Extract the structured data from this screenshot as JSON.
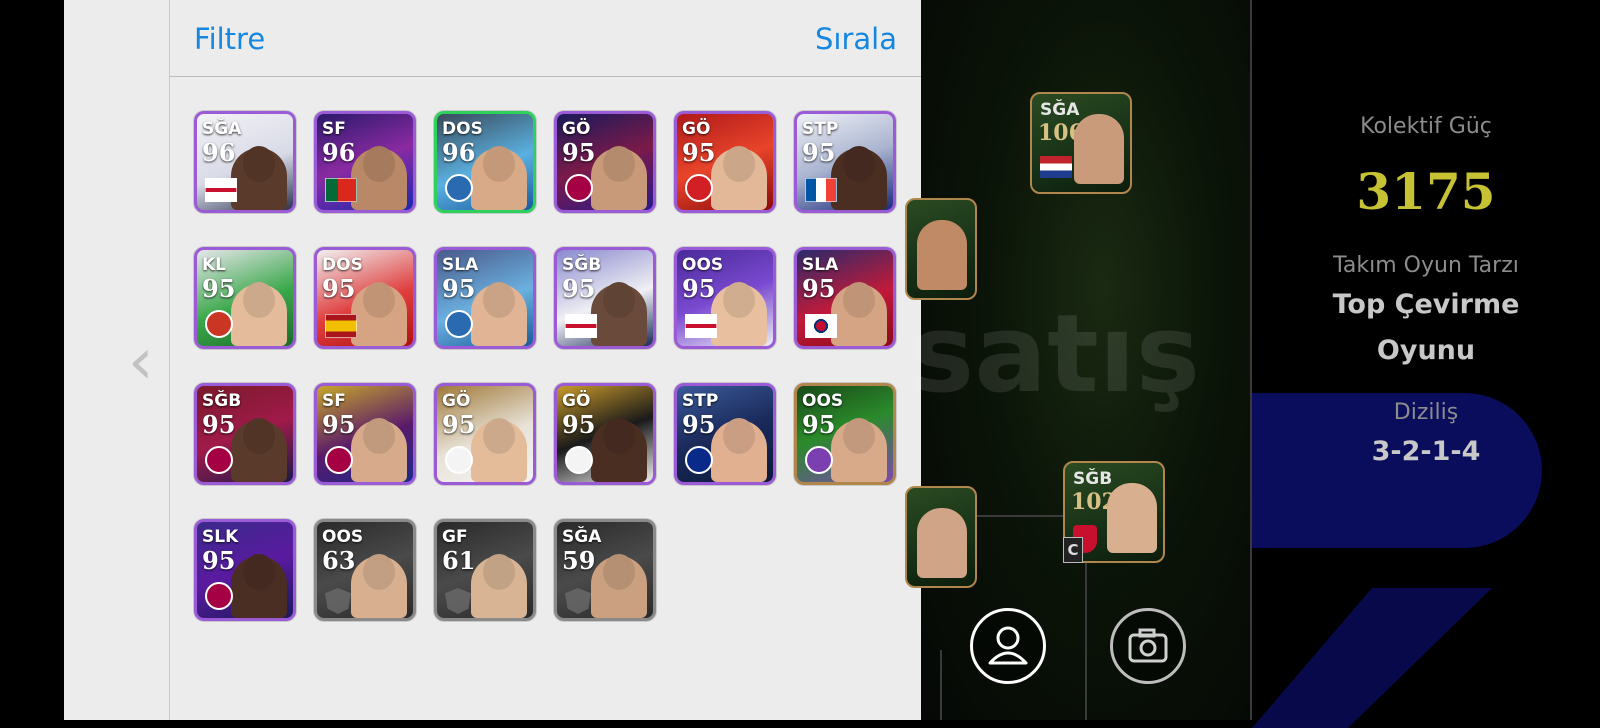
{
  "panel": {
    "filter_label": "Filtre",
    "sort_label": "Sırala",
    "back_glyph": "‹"
  },
  "cards": [
    {
      "pos": "SĞA",
      "rating": "96",
      "badge": "flag-england",
      "border": "#9b5bd6",
      "bg": "linear-gradient(160deg,#f2f2f6 0%,#d8dae6 55%,#2c3350 100%)",
      "skin": "#5a3a2a"
    },
    {
      "pos": "SF",
      "rating": "96",
      "badge": "flag-portugal",
      "border": "#9b5bd6",
      "bg": "linear-gradient(160deg,#2a1a6a 0%,#8a2aa2 50%,#1a2ab0 100%)",
      "skin": "#b98866"
    },
    {
      "pos": "DOS",
      "rating": "96",
      "badge": "club-crest-blue",
      "border": "#2ed15c",
      "bg": "linear-gradient(160deg,#3a4a5a 0%,#5ab0e0 55%,#1a5aa0 100%)",
      "skin": "#d9aa88"
    },
    {
      "pos": "GÖ",
      "rating": "95",
      "badge": "club-crest-barcelona",
      "border": "#9b5bd6",
      "bg": "linear-gradient(160deg,#1a1a5a 0%,#7a1a4a 50%,#2a1a8a 100%)",
      "skin": "#c99a7a"
    },
    {
      "pos": "GÖ",
      "rating": "95",
      "badge": "club-crest-athletic",
      "border": "#9b5bd6",
      "bg": "linear-gradient(160deg,#b01a1a 0%,#e8442a 50%,#8a0a0a 100%)",
      "skin": "#e2b898"
    },
    {
      "pos": "STP",
      "rating": "95",
      "badge": "flag-france",
      "border": "#9b5bd6",
      "bg": "linear-gradient(160deg,#eef0f6 0%,#aab4d0 50%,#1a2a7a 100%)",
      "skin": "#4a2e22"
    },
    {
      "pos": "KL",
      "rating": "95",
      "badge": "club-crest-atletico",
      "border": "#9b5bd6",
      "bg": "linear-gradient(160deg,#e6e6ea 0%,#3aa84a 55%,#1a6a2a 100%)",
      "skin": "#e4bc9c"
    },
    {
      "pos": "DOS",
      "rating": "95",
      "badge": "flag-spain",
      "border": "#9b5bd6",
      "bg": "linear-gradient(160deg,#f0f0f0 0%,#e04040 55%,#b01010 100%)",
      "skin": "#d6a482"
    },
    {
      "pos": "SLA",
      "rating": "95",
      "badge": "club-crest-blue",
      "border": "#9b5bd6",
      "bg": "linear-gradient(160deg,#4a5a8a 0%,#6ab0e0 55%,#1a5a9a 100%)",
      "skin": "#e0b494"
    },
    {
      "pos": "SĞB",
      "rating": "95",
      "badge": "flag-england",
      "border": "#9b5bd6",
      "bg": "linear-gradient(160deg,#8a8ad0 0%,#f0f0f4 55%,#1a2a5a 100%)",
      "skin": "#6a4a3a"
    },
    {
      "pos": "OOS",
      "rating": "95",
      "badge": "flag-england",
      "border": "#9b5bd6",
      "bg": "linear-gradient(160deg,#4a2a9a 0%,#7a4ad0 50%,#eceef6 100%)",
      "skin": "#e8c0a0"
    },
    {
      "pos": "SLA",
      "rating": "95",
      "badge": "flag-korea",
      "border": "#9b5bd6",
      "bg": "linear-gradient(160deg,#2a2a6a 0%,#c01a3a 55%,#8a0a1a 100%)",
      "skin": "#d4a484"
    },
    {
      "pos": "SĞB",
      "rating": "95",
      "badge": "club-crest-barcelona",
      "border": "#9b5bd6",
      "bg": "linear-gradient(160deg,#7a1a2a 0%,#a01a4a 50%,#1a1a4a 100%)",
      "skin": "#5a3a2a"
    },
    {
      "pos": "SF",
      "rating": "95",
      "badge": "club-crest-barcelona",
      "border": "#9b5bd6",
      "bg": "linear-gradient(160deg,#c6a62a 0%,#5a1a6a 55%,#1a2a8a 100%)",
      "skin": "#d6aa8a"
    },
    {
      "pos": "GÖ",
      "rating": "95",
      "badge": "club-crest-white",
      "border": "#9b5bd6",
      "bg": "linear-gradient(160deg,#a07a3a 0%,#e8e2d8 55%,#f4f4f4 100%)",
      "skin": "#e4bc9a"
    },
    {
      "pos": "GÖ",
      "rating": "95",
      "badge": "club-crest-white",
      "border": "#9b5bd6",
      "bg": "linear-gradient(160deg,#c89a2a 0%,#1a1a1a 50%,#eeeeee 100%)",
      "skin": "#4a2e22"
    },
    {
      "pos": "STP",
      "rating": "95",
      "badge": "club-crest-inter",
      "border": "#9b5bd6",
      "bg": "linear-gradient(160deg,#3a5a9a 0%,#1a2a5a 50%,#0a1a3a 100%)",
      "skin": "#e0b090"
    },
    {
      "pos": "OOS",
      "rating": "95",
      "badge": "club-crest-purple",
      "border": "#b0864c",
      "bg": "linear-gradient(160deg,#1a4a1a 0%,#2a8a2a 45%,#7a4ab0 100%)",
      "skin": "#d8aa8a"
    },
    {
      "pos": "SLK",
      "rating": "95",
      "badge": "club-crest-barcelona",
      "border": "#9b5bd6",
      "bg": "linear-gradient(160deg,#3a2a8a 0%,#5a1aa0 50%,#1a1a5a 100%)",
      "skin": "#4a2e24"
    },
    {
      "pos": "OOS",
      "rating": "63",
      "badge": "gray-crest",
      "border": "#8a8a8a",
      "bg": "linear-gradient(160deg,#2a2a2a 0%,#4a4a4a 50%,#2a2a2a 100%)",
      "skin": "#d8b090"
    },
    {
      "pos": "GF",
      "rating": "61",
      "badge": "gray-crest",
      "border": "#8a8a8a",
      "bg": "linear-gradient(160deg,#2a2a2a 0%,#4a4a4a 50%,#2a2a2a 100%)",
      "skin": "#d8b494"
    },
    {
      "pos": "SĞA",
      "rating": "59",
      "badge": "gray-crest",
      "border": "#8a8a8a",
      "bg": "linear-gradient(160deg,#2a2a2a 0%,#4a4a4a 50%,#2a2a2a 100%)",
      "skin": "#caa080"
    }
  ],
  "formation_cards": [
    {
      "pos": "SĞA",
      "rating": "106",
      "flag": "flag-netherlands"
    },
    {
      "pos": "SĞB",
      "rating": "102",
      "flag": "club-crest-arsenal"
    }
  ],
  "captain_label": "C",
  "watermark": "satış",
  "info": {
    "power_label": "Kolektif Güç",
    "power_value": "3175",
    "style_label": "Takım Oyun Tarzı",
    "style_value_line1": "Top Çevirme",
    "style_value_line2": "Oyunu",
    "formation_label": "Diziliş",
    "formation_value": "3-2-1-4"
  }
}
